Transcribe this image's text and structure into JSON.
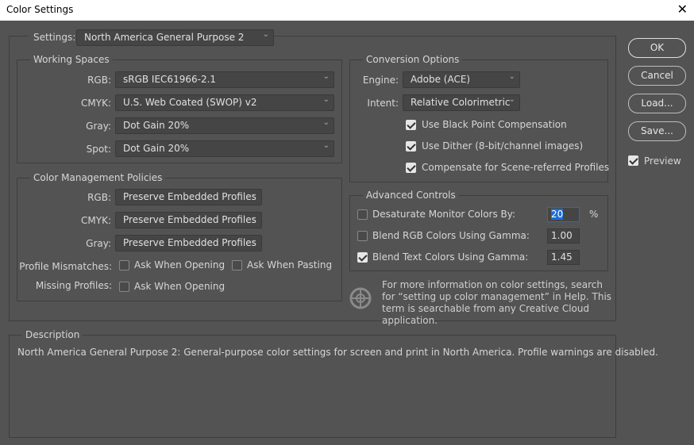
{
  "window": {
    "title": "Color Settings",
    "close": "✕"
  },
  "settings": {
    "label": "Settings:",
    "value": "North America General Purpose 2"
  },
  "working_spaces": {
    "title": "Working Spaces",
    "rows": [
      {
        "label": "RGB:",
        "value": "sRGB IEC61966-2.1"
      },
      {
        "label": "CMYK:",
        "value": "U.S. Web Coated (SWOP) v2"
      },
      {
        "label": "Gray:",
        "value": "Dot Gain 20%"
      },
      {
        "label": "Spot:",
        "value": "Dot Gain 20%"
      }
    ]
  },
  "policies": {
    "title": "Color Management Policies",
    "rows": [
      {
        "label": "RGB:",
        "value": "Preserve Embedded Profiles"
      },
      {
        "label": "CMYK:",
        "value": "Preserve Embedded Profiles"
      },
      {
        "label": "Gray:",
        "value": "Preserve Embedded Profiles"
      }
    ],
    "mismatch_label": "Profile Mismatches:",
    "ask_opening": "Ask When Opening",
    "ask_pasting": "Ask When Pasting",
    "missing_label": "Missing Profiles:",
    "missing_ask_opening": "Ask When Opening",
    "mismatch_opening_checked": false,
    "mismatch_pasting_checked": false,
    "missing_opening_checked": false
  },
  "conversion": {
    "title": "Conversion Options",
    "engine_label": "Engine:",
    "engine": "Adobe (ACE)",
    "intent_label": "Intent:",
    "intent": "Relative Colorimetric",
    "checks": [
      {
        "label": "Use Black Point Compensation",
        "checked": true
      },
      {
        "label": "Use Dither (8-bit/channel images)",
        "checked": true
      },
      {
        "label": "Compensate for Scene-referred Profiles",
        "checked": true
      }
    ]
  },
  "advanced": {
    "title": "Advanced Controls",
    "rows": [
      {
        "label": "Desaturate Monitor Colors By:",
        "value": "20",
        "unit": "%",
        "checked": false
      },
      {
        "label": "Blend RGB Colors Using Gamma:",
        "value": "1.00",
        "checked": false
      },
      {
        "label": "Blend Text Colors Using Gamma:",
        "value": "1.45",
        "checked": true
      }
    ]
  },
  "info": {
    "icon": "color-wheel-icon",
    "text": "For more information on color settings, search for “setting up color management” in Help. This term is searchable from any Creative Cloud application."
  },
  "description": {
    "title": "Description",
    "text": "North America General Purpose 2:  General-purpose color settings for screen and print in North America. Profile warnings are disabled."
  },
  "buttons": {
    "ok": "OK",
    "cancel": "Cancel",
    "load": "Load...",
    "save": "Save...",
    "preview": "Preview",
    "preview_checked": true
  },
  "colors": {
    "background": "#535353",
    "selection": "#1a6fd6"
  }
}
